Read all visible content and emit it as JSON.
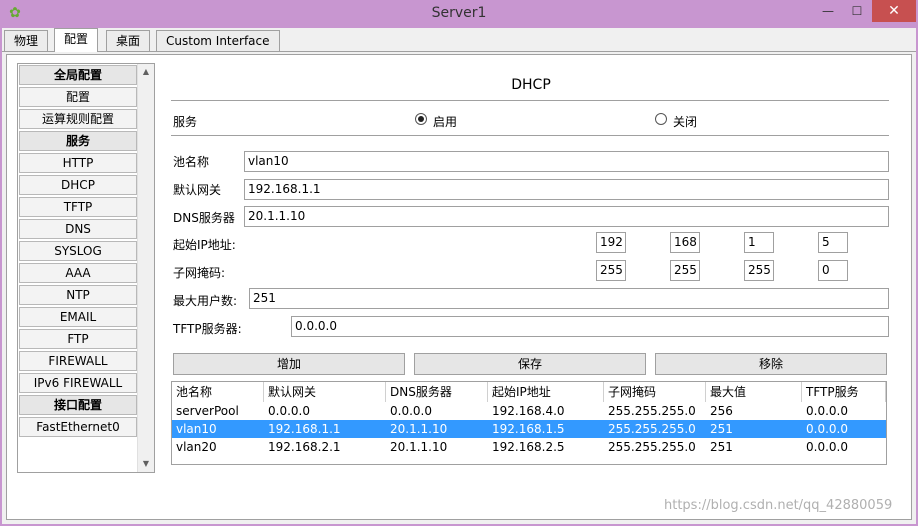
{
  "window": {
    "title": "Server1",
    "min": "—",
    "max": "☐",
    "close": "✕"
  },
  "tabs": [
    {
      "label": "物理"
    },
    {
      "label": "配置"
    },
    {
      "label": "桌面"
    },
    {
      "label": "Custom Interface"
    }
  ],
  "sidebar": {
    "items": [
      {
        "label": "全局配置",
        "head": true
      },
      {
        "label": "配置"
      },
      {
        "label": "运算规则配置"
      },
      {
        "label": "服务",
        "head": true
      },
      {
        "label": "HTTP"
      },
      {
        "label": "DHCP"
      },
      {
        "label": "TFTP"
      },
      {
        "label": "DNS"
      },
      {
        "label": "SYSLOG"
      },
      {
        "label": "AAA"
      },
      {
        "label": "NTP"
      },
      {
        "label": "EMAIL"
      },
      {
        "label": "FTP"
      },
      {
        "label": "FIREWALL"
      },
      {
        "label": "IPv6 FIREWALL"
      },
      {
        "label": "接口配置",
        "head": true
      },
      {
        "label": "FastEthernet0"
      }
    ]
  },
  "dhcp": {
    "title": "DHCP",
    "service_label": "服务",
    "on_label": "启用",
    "off_label": "关闭",
    "pool_name_label": "池名称",
    "pool_name": "vlan10",
    "gateway_label": "默认网关",
    "gateway": "192.168.1.1",
    "dns_label": "DNS服务器",
    "dns": "20.1.1.10",
    "start_ip_label": "起始IP地址:",
    "start_ip": [
      "192",
      "168",
      "1",
      "5"
    ],
    "mask_label": "子网掩码:",
    "mask": [
      "255",
      "255",
      "255",
      "0"
    ],
    "max_users_label": "最大用户数:",
    "max_users": "251",
    "tftp_label": "TFTP服务器:",
    "tftp": "0.0.0.0",
    "add_label": "增加",
    "save_label": "保存",
    "remove_label": "移除"
  },
  "table": {
    "headers": [
      "池名称",
      "默认网关",
      "DNS服务器",
      "起始IP地址",
      "子网掩码",
      "最大值",
      "TFTP服务"
    ],
    "rows": [
      [
        "serverPool",
        "0.0.0.0",
        "0.0.0.0",
        "192.168.4.0",
        "255.255.255.0",
        "256",
        "0.0.0.0"
      ],
      [
        "vlan10",
        "192.168.1.1",
        "20.1.1.10",
        "192.168.1.5",
        "255.255.255.0",
        "251",
        "0.0.0.0"
      ],
      [
        "vlan20",
        "192.168.2.1",
        "20.1.1.10",
        "192.168.2.5",
        "255.255.255.0",
        "251",
        "0.0.0.0"
      ]
    ],
    "selected_row": 1
  },
  "watermark": "https://blog.csdn.net/qq_42880059"
}
